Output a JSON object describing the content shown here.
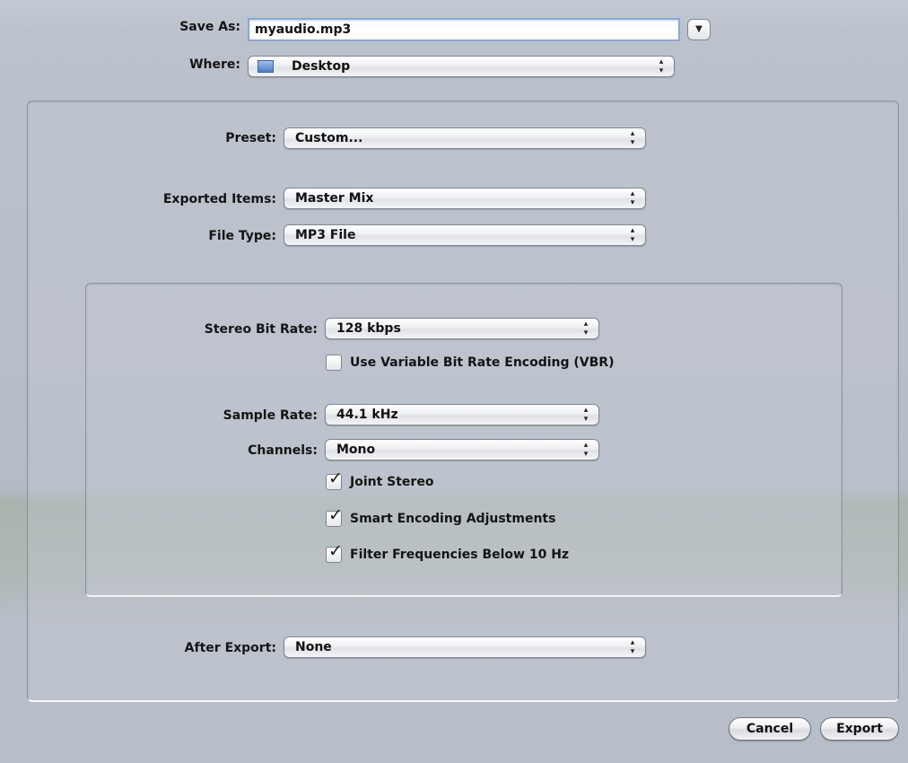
{
  "header": {
    "save_as_label": "Save As:",
    "save_as_value": "myaudio.mp3",
    "where_label": "Where:",
    "where_value": "Desktop"
  },
  "export": {
    "preset_label": "Preset:",
    "preset_value": "Custom...",
    "exported_items_label": "Exported Items:",
    "exported_items_value": "Master Mix",
    "file_type_label": "File Type:",
    "file_type_value": "MP3 File",
    "after_export_label": "After Export:",
    "after_export_value": "None"
  },
  "mp3": {
    "stereo_bit_rate_label": "Stereo Bit Rate:",
    "stereo_bit_rate_value": "128 kbps",
    "vbr_label": "Use Variable Bit Rate Encoding (VBR)",
    "vbr_checked": false,
    "sample_rate_label": "Sample Rate:",
    "sample_rate_value": "44.1 kHz",
    "channels_label": "Channels:",
    "channels_value": "Mono",
    "joint_stereo_label": "Joint Stereo",
    "joint_stereo_checked": true,
    "smart_encoding_label": "Smart Encoding Adjustments",
    "smart_encoding_checked": true,
    "filter_label": "Filter Frequencies Below 10 Hz",
    "filter_checked": true
  },
  "buttons": {
    "cancel": "Cancel",
    "export": "Export"
  },
  "icons": {
    "popup_arrows": "up-down-arrows-icon",
    "disclosure": "chevron-down-icon",
    "where_folder": "desktop-folder-icon",
    "checkmark": "checkmark-icon"
  }
}
